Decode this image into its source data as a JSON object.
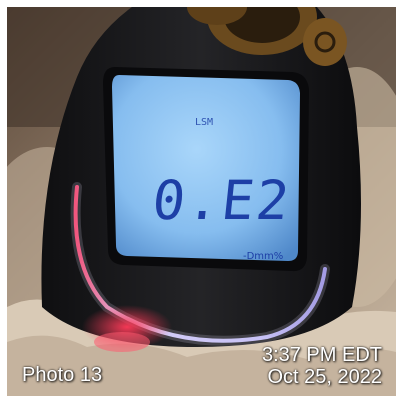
{
  "photo": {
    "label": "Photo 13",
    "time": "3:37 PM EDT",
    "date": "Oct 25, 2022",
    "subject": "handheld-meter-with-backlit-lcd",
    "lcd": {
      "mode": "LSM",
      "reading": "0.E2",
      "unit": "-Dmm%",
      "backlight_color": "#8fc6f2",
      "digit_color": "#1d3fa6"
    },
    "colors": {
      "device_body": "#1b1b1d",
      "carpet": "#b8a692",
      "glow_blue": "#b9b4ff",
      "glow_red": "#ff2a4a"
    }
  }
}
